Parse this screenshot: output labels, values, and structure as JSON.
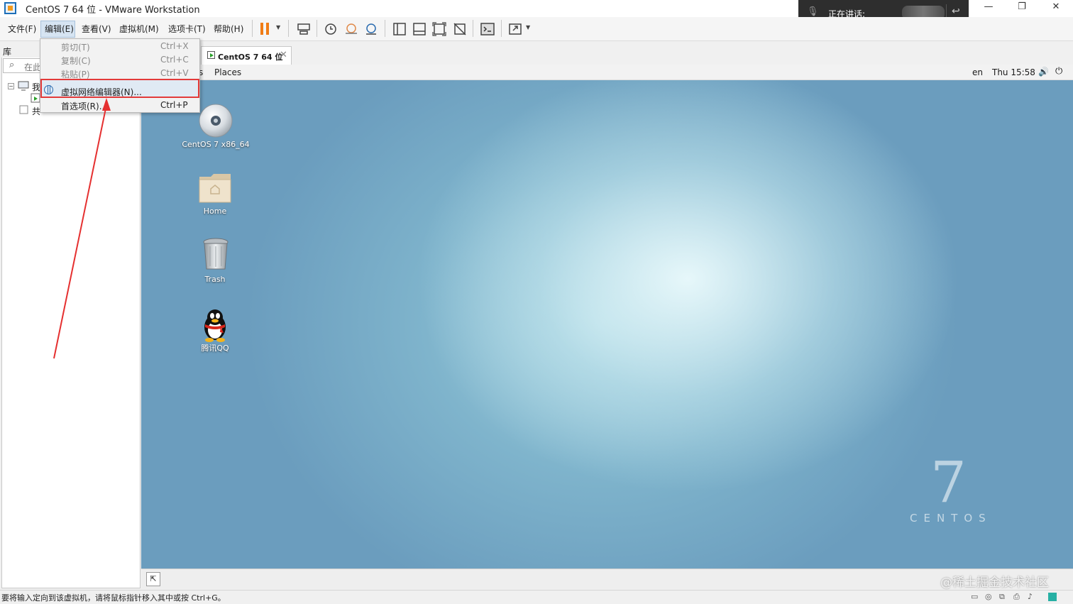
{
  "window": {
    "title": "CentOS 7 64 位 - VMware Workstation",
    "minimize": "—",
    "restore": "❐",
    "close": "✕"
  },
  "talk_overlay": {
    "label": "正在讲话:"
  },
  "menubar": {
    "items": [
      "文件(F)",
      "编辑(E)",
      "查看(V)",
      "虚拟机(M)",
      "选项卡(T)",
      "帮助(H)"
    ]
  },
  "toolbar": {
    "icons": [
      "pause-icon",
      "send-ctrl-alt-del-icon",
      "snapshot-icon",
      "revert-snapshot-icon",
      "snapshot-manager-icon",
      "library-view-icon",
      "thumbnail-view-icon",
      "fullscreen-icon",
      "unity-icon",
      "console-icon",
      "stretch-icon"
    ]
  },
  "edit_menu": {
    "items": [
      {
        "label": "剪切(T)",
        "shortcut": "Ctrl+X",
        "enabled": false
      },
      {
        "label": "复制(C)",
        "shortcut": "Ctrl+C",
        "enabled": false
      },
      {
        "label": "粘贴(P)",
        "shortcut": "Ctrl+V",
        "enabled": false
      },
      {
        "label": "虚拟网络编辑器(N)...",
        "shortcut": "",
        "enabled": true,
        "highlighted": true
      },
      {
        "label": "首选项(R)...",
        "shortcut": "Ctrl+P",
        "enabled": true
      }
    ]
  },
  "library": {
    "title": "库",
    "search_placeholder": "在此",
    "tree": [
      {
        "label": "我",
        "toggle": "−"
      },
      {
        "label": "共"
      }
    ]
  },
  "tab": {
    "label": "CentOS 7 64 位",
    "close": "✕"
  },
  "guest": {
    "topbar": {
      "apps_tail": "s",
      "places": "Places",
      "lang": "en",
      "clock": "Thu 15:58"
    },
    "desktop_icons": [
      {
        "label": "CentOS 7 x86_64",
        "icon": "disc-icon"
      },
      {
        "label": "Home",
        "icon": "home-folder-icon"
      },
      {
        "label": "Trash",
        "icon": "trash-icon"
      },
      {
        "label": "腾讯QQ",
        "icon": "qq-penguin-icon"
      }
    ],
    "brand_number": "7",
    "brand_word": "CENTOS"
  },
  "statusbar": {
    "message": "要将输入定向到该虚拟机，请将鼠标指针移入其中或按 Ctrl+G。"
  },
  "watermark": "@稀土掘金技术社区",
  "colors": {
    "accent_orange": "#f07c15",
    "highlight_red": "#e33a3a",
    "selection_blue": "#d6e4f2"
  }
}
